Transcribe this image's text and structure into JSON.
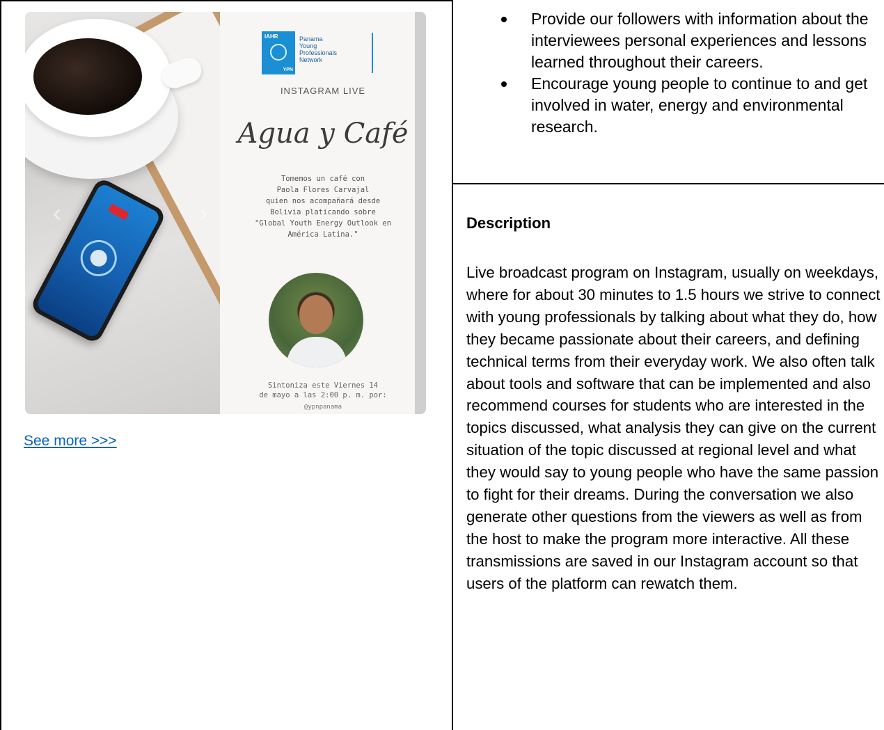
{
  "left": {
    "post_image": {
      "logo_lines": [
        "IAHR",
        "Panama",
        "Young",
        "Professionals",
        "Network",
        "YPN"
      ],
      "instagram_live": "INSTAGRAM LIVE",
      "title": "Agua y Café",
      "body": "Tomemos un café con\nPaola Flores Carvajal\nquien nos acompañará desde\nBolivia platicando sobre\n\"Global Youth Energy Outlook en\nAmérica Latina.\"",
      "date": "Sintoniza este Viernes 14\nde mayo a las 2:00 p. m. por:",
      "handle": "@ypnpanama",
      "phone_badge": "EN VIVO"
    },
    "see_more_label": "See more >>>"
  },
  "right": {
    "bullets": [
      "Provide our followers with information about the interviewees personal experiences and lessons learned throughout their careers.",
      "Encourage young people to continue to and get involved in water, energy and environmental research."
    ],
    "description_title": "Description",
    "description_body": "Live broadcast program on Instagram, usually on weekdays, where for about 30 minutes to 1.5 hours we strive to connect with young professionals by talking about what they do, how they became passionate about their careers, and defining technical terms from their everyday work. We also often talk about tools and software that can be implemented and also recommend courses for students who are interested in the topics discussed, what analysis they can give on the current situation of the topic discussed at regional level and what they would say to young people who have the same passion to fight for their dreams. During the conversation we also generate other questions from the viewers as well as from the host to make the program more interactive. All these transmissions are saved in our Instagram account so that users of the platform can rewatch them."
  },
  "colors": {
    "link": "#0563c1",
    "logo_blue": "#1a8fd3",
    "border": "#000000"
  }
}
